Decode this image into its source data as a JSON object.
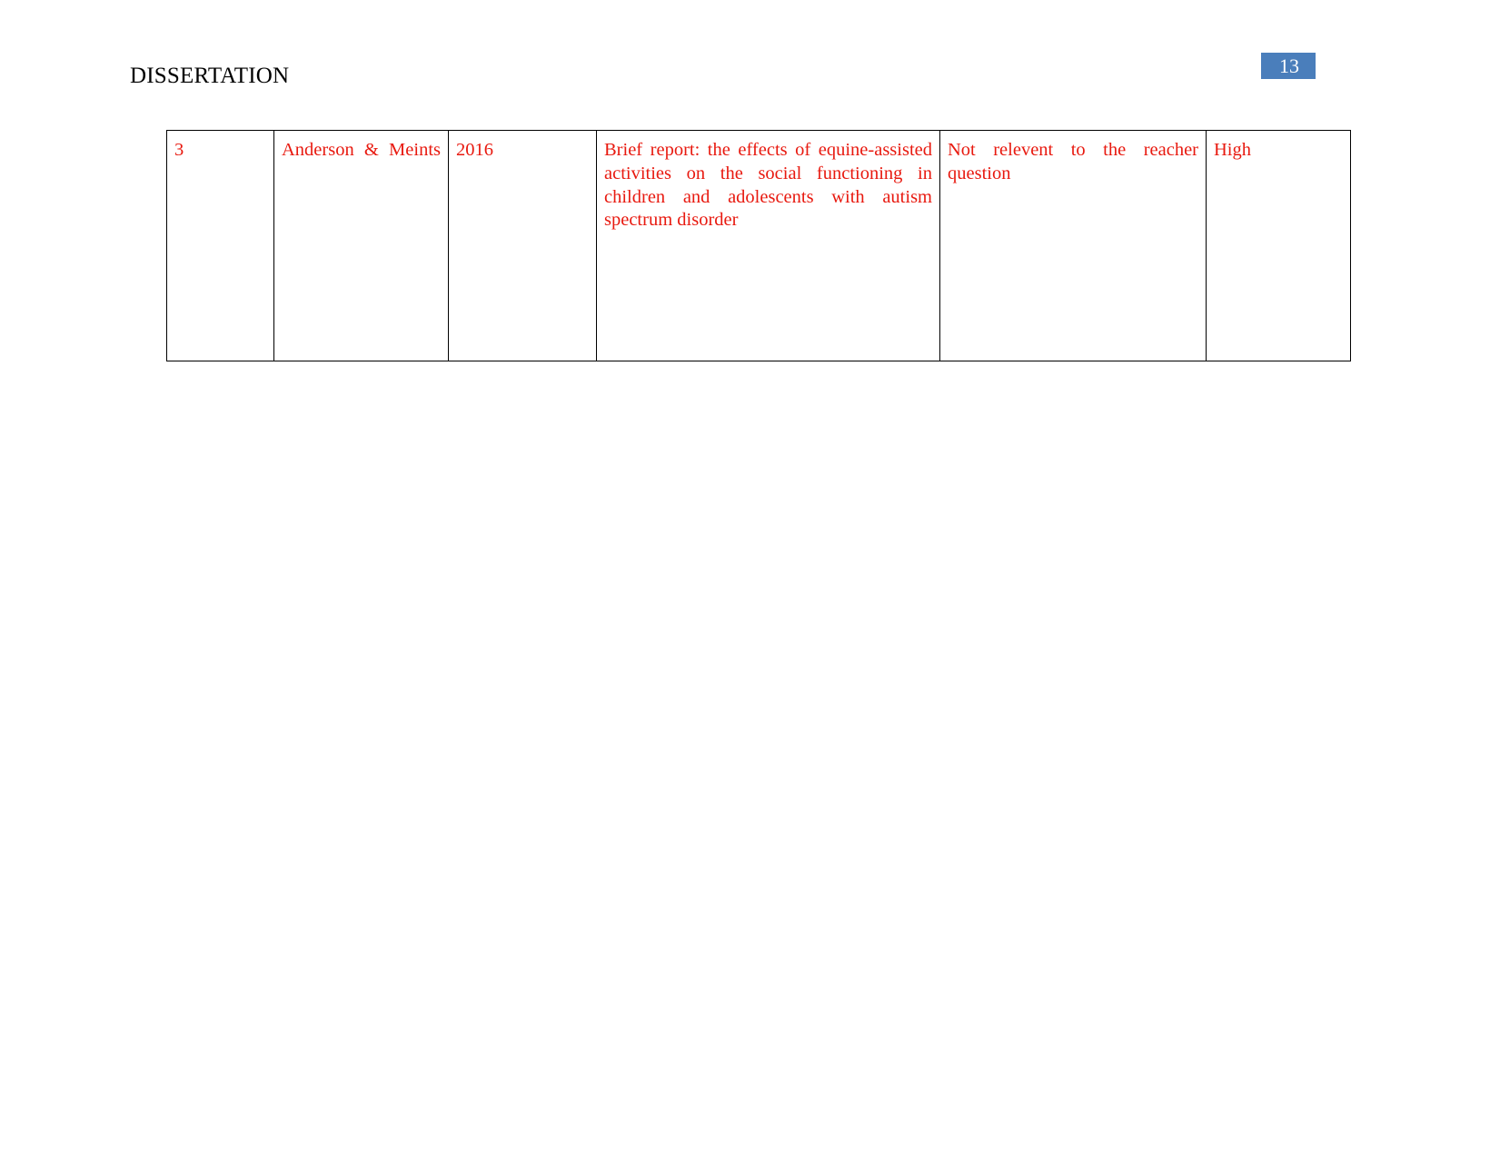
{
  "document": {
    "running_header": "DISSERTATION",
    "page_number": "13"
  },
  "theme": {
    "page_background": "#ffffff",
    "header_text_color": "#000000",
    "page_badge_background": "#4a7ebb",
    "page_badge_text_color": "#ffffff",
    "table_border_color": "#000000",
    "table_text_color": "#e8190f"
  },
  "table": {
    "row": {
      "index": "3",
      "authors": "Anderson & Meints",
      "year": "2016",
      "title": "Brief report: the effects of equine-assisted activities on the social functioning in children and adolescents with autism spectrum disorder",
      "reason": "Not relevent to the reacher question",
      "quality": "High"
    }
  }
}
